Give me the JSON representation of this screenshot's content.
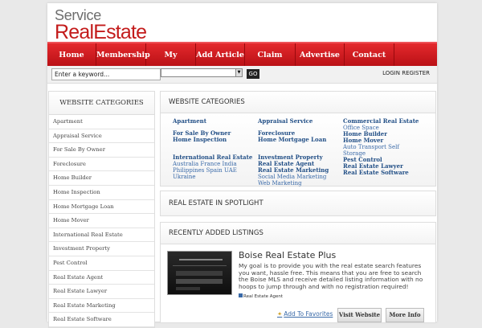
{
  "logo": {
    "line1": "Service",
    "line2": "RealEstate"
  },
  "nav": [
    "Home",
    "Membership",
    "My Account",
    "Add Article",
    "Claim Profile",
    "Advertise",
    "Contact"
  ],
  "search": {
    "keyword_value": "Enter a keyword...",
    "go_label": "GO",
    "login_label": "LOGIN",
    "register_label": "REGISTER"
  },
  "sidebar": {
    "title": "WEBSITE CATEGORIES",
    "items": [
      "Apartment",
      "Appraisal Service",
      "For Sale By Owner",
      "Foreclosure",
      "Home Builder",
      "Home Inspection",
      "Home Mortgage Loan",
      "Home Mover",
      "International Real Estate",
      "Investment Property",
      "Pest Control",
      "Real Estate Agent",
      "Real Estate Lawyer",
      "Real Estate Marketing",
      "Real Estate Software"
    ]
  },
  "categories_box": {
    "title": "WEBSITE CATEGORIES",
    "col1": {
      "apartment": "Apartment",
      "fsbo": "For Sale By Owner",
      "inspection": "Home Inspection",
      "international": "International Real Estate",
      "intl_sub1": "Australia France India",
      "intl_sub2": "Philippines Spain UAE",
      "intl_sub3": "Ukraine"
    },
    "col2": {
      "appraisal": "Appraisal Service",
      "foreclosure": "Foreclosure",
      "mortgage": "Home Mortgage Loan",
      "investment": "Investment Property",
      "agent": "Real Estate Agent",
      "marketing": "Real Estate Marketing",
      "mkt_sub1": "Social Media Marketing",
      "mkt_sub2": "Web Marketing"
    },
    "col3": {
      "commercial": "Commercial Real Estate",
      "comm_sub1": "Office Space",
      "builder": "Home Builder",
      "mover": "Home Mover",
      "mover_sub1": "Auto Transport Self",
      "mover_sub2": "Storage",
      "pest": "Pest Control",
      "lawyer": "Real Estate Lawyer",
      "software": "Real Estate Software"
    }
  },
  "spotlight": {
    "title": "REAL ESTATE IN SPOTLIGHT"
  },
  "recent": {
    "title": "RECENTLY ADDED LISTINGS",
    "listing": {
      "title": "Boise Real Estate Plus",
      "description": "My goal is to provide you with the real estate search features you want, hassle free. This means that you are free to search the Boise MLS and receive detailed listing information with no hoops to jump through and with no registration required!",
      "category": "Real Estate Agent",
      "favorite": "Add To Favorites",
      "visit": "Visit Website",
      "more": "More Info"
    }
  }
}
